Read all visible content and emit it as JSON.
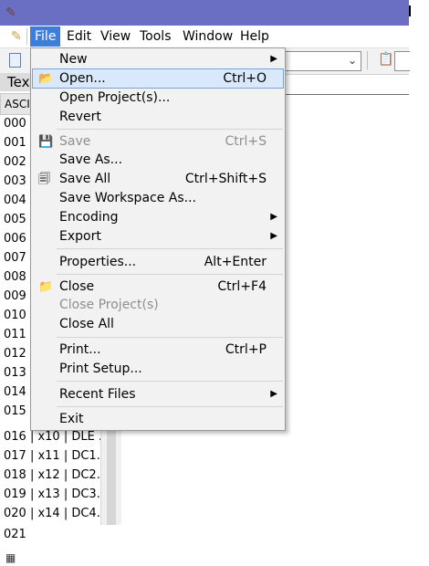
{
  "menubar": {
    "items": [
      "File",
      "Edit",
      "View",
      "Tools",
      "Window",
      "Help"
    ]
  },
  "document_tab": "Tex",
  "panel": {
    "header": "ASCI",
    "rows": [
      "000",
      "001",
      "002",
      "003",
      "004",
      "005",
      "006",
      "007",
      "008",
      "009",
      "010",
      "011",
      "012",
      "013",
      "014",
      "015",
      "016 | x10 | DLE ...",
      "017 | x11 | DC1...",
      "018 | x12 | DC2...",
      "019 | x13 | DC3...",
      "020 | x14 | DC4...",
      "021"
    ]
  },
  "file_menu": {
    "new": "New",
    "open": "Open...",
    "open_shortcut": "Ctrl+O",
    "open_project": "Open Project(s)...",
    "revert": "Revert",
    "save": "Save",
    "save_shortcut": "Ctrl+S",
    "save_as": "Save As...",
    "save_all": "Save All",
    "save_all_shortcut": "Ctrl+Shift+S",
    "save_workspace": "Save Workspace As...",
    "encoding": "Encoding",
    "export": "Export",
    "properties": "Properties...",
    "properties_shortcut": "Alt+Enter",
    "close": "Close",
    "close_shortcut": "Ctrl+F4",
    "close_project": "Close Project(s)",
    "close_all": "Close All",
    "print": "Print...",
    "print_shortcut": "Ctrl+P",
    "print_setup": "Print Setup...",
    "recent_files": "Recent Files",
    "exit": "Exit"
  },
  "icons": {
    "submenu_arrow": "▶",
    "combo_arrow": "⌄",
    "open_folder": "📂",
    "close_folder": "📁",
    "save_disk": "💾",
    "save_all_disks": "🗐"
  },
  "colors": {
    "title_bar": "#6b6fc4",
    "menu_highlight": "#3d7edb",
    "menu_hover": "#d9e8fb",
    "disabled_text": "#8e8e8e"
  }
}
